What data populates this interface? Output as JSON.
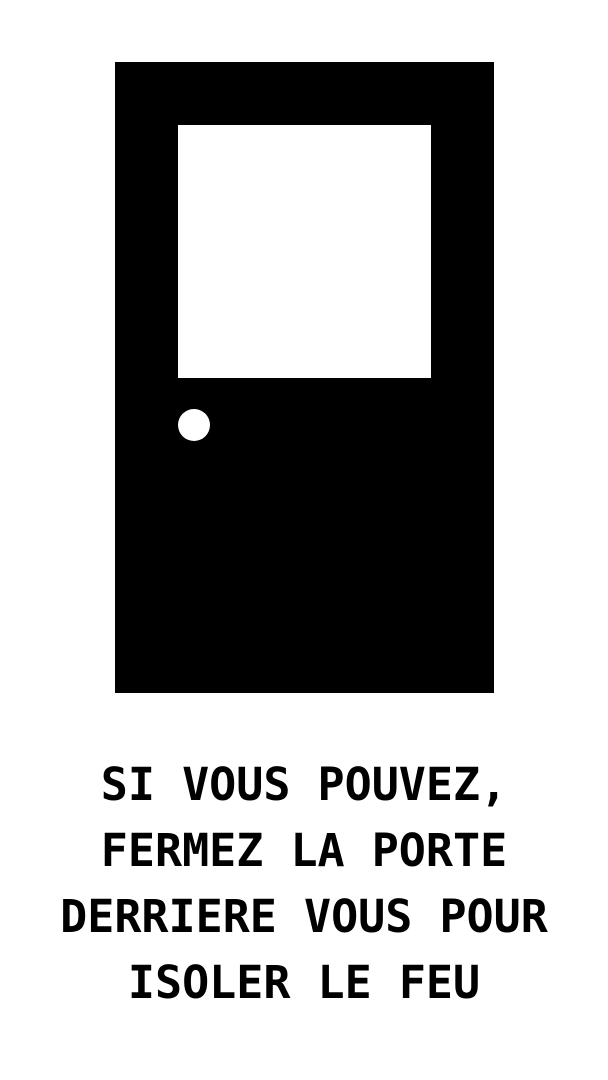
{
  "colors": {
    "background": "#ffffff",
    "foreground": "#000000"
  },
  "graphic": {
    "icon": "door-icon"
  },
  "message": {
    "lines": [
      "SI VOUS POUVEZ,",
      "FERMEZ LA PORTE",
      "DERRIERE VOUS POUR",
      "ISOLER LE FEU"
    ]
  }
}
